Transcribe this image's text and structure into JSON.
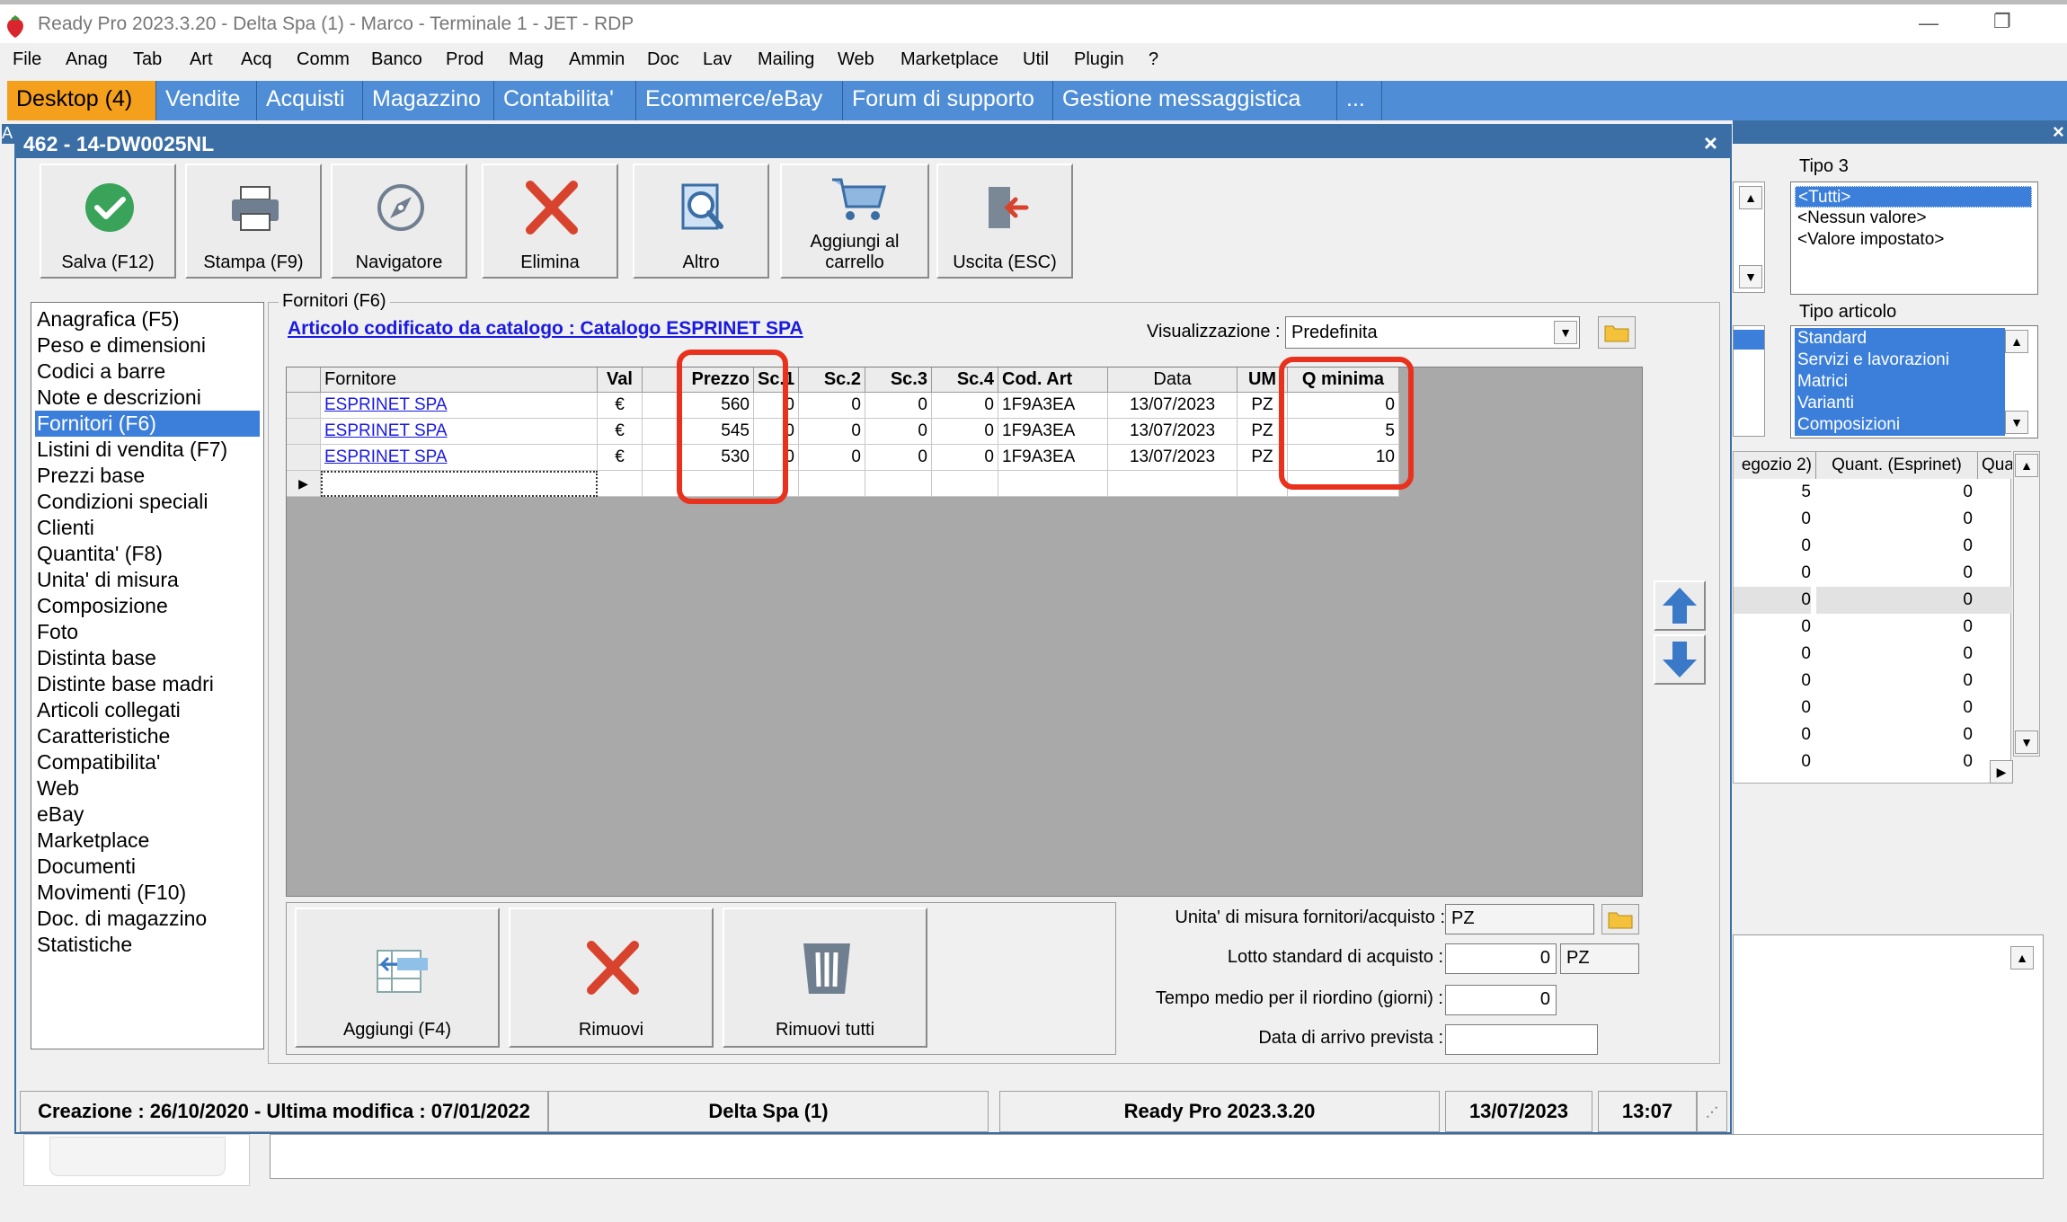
{
  "window": {
    "title": "Ready Pro 2023.3.20 - Delta Spa (1) - Marco - Terminale 1 - JET - RDP",
    "minimize": "—",
    "restore": "❐"
  },
  "menu": [
    "File",
    "Anag",
    "Tab",
    "Art",
    "Acq",
    "Comm",
    "Banco",
    "Prod",
    "Mag",
    "Ammin",
    "Doc",
    "Lav",
    "Mailing",
    "Web",
    "Marketplace",
    "Util",
    "Plugin",
    "?"
  ],
  "tabs": [
    "Desktop (4)",
    "Vendite",
    "Acquisti",
    "Magazzino",
    "Contabilita'",
    "Ecommerce/eBay",
    "Forum di supporto",
    "Gestione messaggistica",
    "..."
  ],
  "dialog": {
    "title": "462 - 14-DW0025NL",
    "close": "×",
    "toolbar": [
      {
        "label": "Salva (F12)",
        "icon": "check-icon"
      },
      {
        "label": "Stampa (F9)",
        "icon": "printer-icon"
      },
      {
        "label": "Navigatore",
        "icon": "compass-icon"
      },
      {
        "label": "Elimina",
        "icon": "delete-x-icon"
      },
      {
        "label": "Altro",
        "icon": "search-document-icon"
      },
      {
        "label": "Aggiungi al carrello",
        "icon": "cart-icon"
      },
      {
        "label": "Uscita (ESC)",
        "icon": "exit-door-icon"
      }
    ],
    "nav": [
      "Anagrafica (F5)",
      "Peso e dimensioni",
      "Codici a barre",
      "Note e descrizioni",
      "Fornitori (F6)",
      "Listini di vendita (F7)",
      "Prezzi base",
      "Condizioni speciali",
      "Clienti",
      "Quantita' (F8)",
      "Unita' di misura",
      "Composizione",
      "Foto",
      "Distinta base",
      "Distinte base madri",
      "Articoli collegati",
      "Caratteristiche",
      "Compatibilita'",
      "Web",
      "eBay",
      "Marketplace",
      "Documenti",
      "Movimenti (F10)",
      "Doc. di magazzino",
      "Statistiche"
    ],
    "nav_selected": 4,
    "group_title": "Fornitori (F6)",
    "catalog_link": "Articolo codificato da catalogo : Catalogo ESPRINET SPA",
    "view_label": "Visualizzazione :",
    "view_value": "Predefinita",
    "columns": [
      "Fornitore",
      "Val",
      "Prezzo",
      "Sc.1",
      "Sc.2",
      "Sc.3",
      "Sc.4",
      "Cod. Art",
      "Data",
      "UM",
      "Q minima"
    ],
    "rows": [
      {
        "fornitore": "ESPRINET SPA",
        "val": "€",
        "prezzo": "560",
        "sc1": "0",
        "sc2": "0",
        "sc3": "0",
        "sc4": "0",
        "cod": "1F9A3EA",
        "data": "13/07/2023",
        "um": "PZ",
        "qmin": "0"
      },
      {
        "fornitore": "ESPRINET SPA",
        "val": "€",
        "prezzo": "545",
        "sc1": "0",
        "sc2": "0",
        "sc3": "0",
        "sc4": "0",
        "cod": "1F9A3EA",
        "data": "13/07/2023",
        "um": "PZ",
        "qmin": "5"
      },
      {
        "fornitore": "ESPRINET SPA",
        "val": "€",
        "prezzo": "530",
        "sc1": "0",
        "sc2": "0",
        "sc3": "0",
        "sc4": "0",
        "cod": "1F9A3EA",
        "data": "13/07/2023",
        "um": "PZ",
        "qmin": "10"
      }
    ],
    "bottom_buttons": [
      {
        "label": "Aggiungi (F4)",
        "icon": "add-row-icon"
      },
      {
        "label": "Rimuovi",
        "icon": "remove-x-icon"
      },
      {
        "label": "Rimuovi tutti",
        "icon": "trash-icon"
      }
    ],
    "form": {
      "um_label": "Unita' di misura fornitori/acquisto :",
      "um_value": "PZ",
      "lotto_label": "Lotto standard di acquisto :",
      "lotto_value": "0",
      "lotto_um": "PZ",
      "tempo_label": "Tempo medio per il riordino (giorni) :",
      "tempo_value": "0",
      "arrivo_label": "Data di arrivo prevista :",
      "arrivo_value": ""
    },
    "status": {
      "created": "Creazione : 26/10/2020 - Ultima modifica : 07/01/2022",
      "company": "Delta Spa (1)",
      "version": "Ready Pro 2023.3.20",
      "date": "13/07/2023",
      "time": "13:07"
    }
  },
  "background": {
    "tipo3_label": "Tipo 3",
    "tipo3_items": [
      "<Tutti>",
      "<Nessun valore>",
      "<Valore impostato>"
    ],
    "tipo_articolo_label": "Tipo articolo",
    "tipo_articolo_items": [
      "Standard",
      "Servizi e lavorazioni",
      "Matrici",
      "Varianti",
      "Composizioni"
    ],
    "col_headers": [
      "egozio 2)",
      "Quant. (Esprinet)",
      "Qua"
    ],
    "col1": [
      "5",
      "0",
      "0",
      "0",
      "0",
      "0",
      "0",
      "0",
      "0",
      "0",
      "0"
    ],
    "col2": [
      "0",
      "0",
      "0",
      "0",
      "0",
      "0",
      "0",
      "0",
      "0",
      "0",
      "0"
    ],
    "left_edge": "A"
  }
}
